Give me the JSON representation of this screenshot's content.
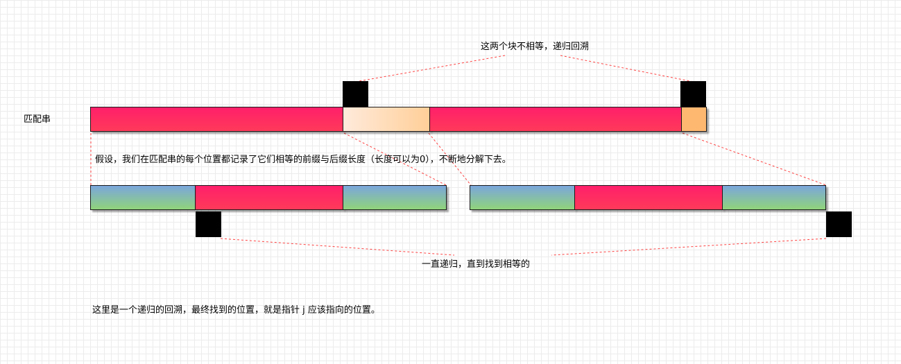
{
  "labels": {
    "match_string": "匹配串",
    "top_note": "这两个块不相等，递归回溯",
    "middle_note": "假设，我们在匹配串的每个位置都记录了它们相等的前缀与后缀长度（长度可以为0），不断地分解下去。",
    "bottom_note": "一直递归，直到找到相等的",
    "footer_note": "这里是一个递归的回溯，最终找到的位置，就是指针 j 应该指向的位置。"
  },
  "colors": {
    "pink": "#ff2a62",
    "peach": "#ffdcbf",
    "orange": "#ffb870",
    "blue_green_top": "#7aa6dc",
    "blue_green_bottom": "#90d47a",
    "marker": "#000000",
    "connector": "#ff3b3b"
  }
}
